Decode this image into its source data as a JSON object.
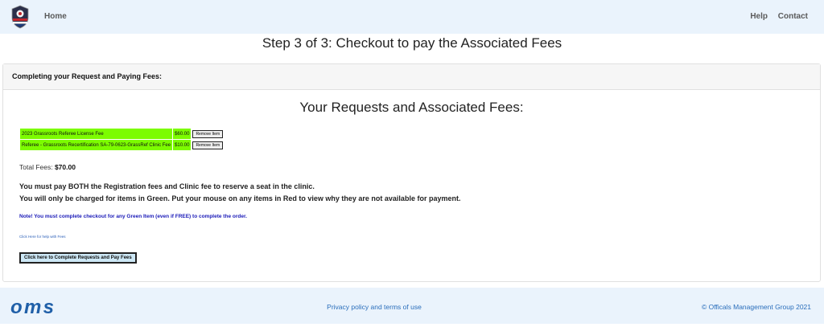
{
  "nav": {
    "home": "Home",
    "help": "Help",
    "contact": "Contact"
  },
  "step_title": "Step 3 of 3: Checkout to pay the Associated Fees",
  "card": {
    "header": "Completing your Request and Paying Fees:",
    "title": "Your Requests and Associated Fees:",
    "fees": [
      {
        "name": "2023 Grassroots Referee License Fee",
        "amount": "$60.00",
        "button": "Remove Item"
      },
      {
        "name": "Referee - Grassroots Recertification SA-79-0623-GrassRef Clinic Fee",
        "amount": "$10.00",
        "button": "Remove Item"
      }
    ],
    "total_label": "Total Fees:",
    "total_value": "$70.00",
    "message1": "You must pay BOTH the Registration fees and Clinic fee to reserve a seat in the clinic.",
    "message2": "You will only be charged for items in Green. Put your mouse on any items in Red to view why they are not available for payment.",
    "note": "Note! You must complete checkout for any Green Item (even if FREE) to complete the order.",
    "help_link": "Click Here for help with Fees",
    "pay_button": "Click here to Complete Requests and Pay Fees"
  },
  "footer": {
    "privacy": "Privacy policy and terms of use",
    "copyright": "© Officals Management Group 2021"
  },
  "colors": {
    "green_item": "#7cfc00",
    "nav_bg": "#eaf3fc",
    "link": "#2a6ebb",
    "note": "#1a1ab8"
  },
  "icons": {
    "site_logo": "referee-program-badge-logo",
    "footer_logo": "oms-logo"
  }
}
